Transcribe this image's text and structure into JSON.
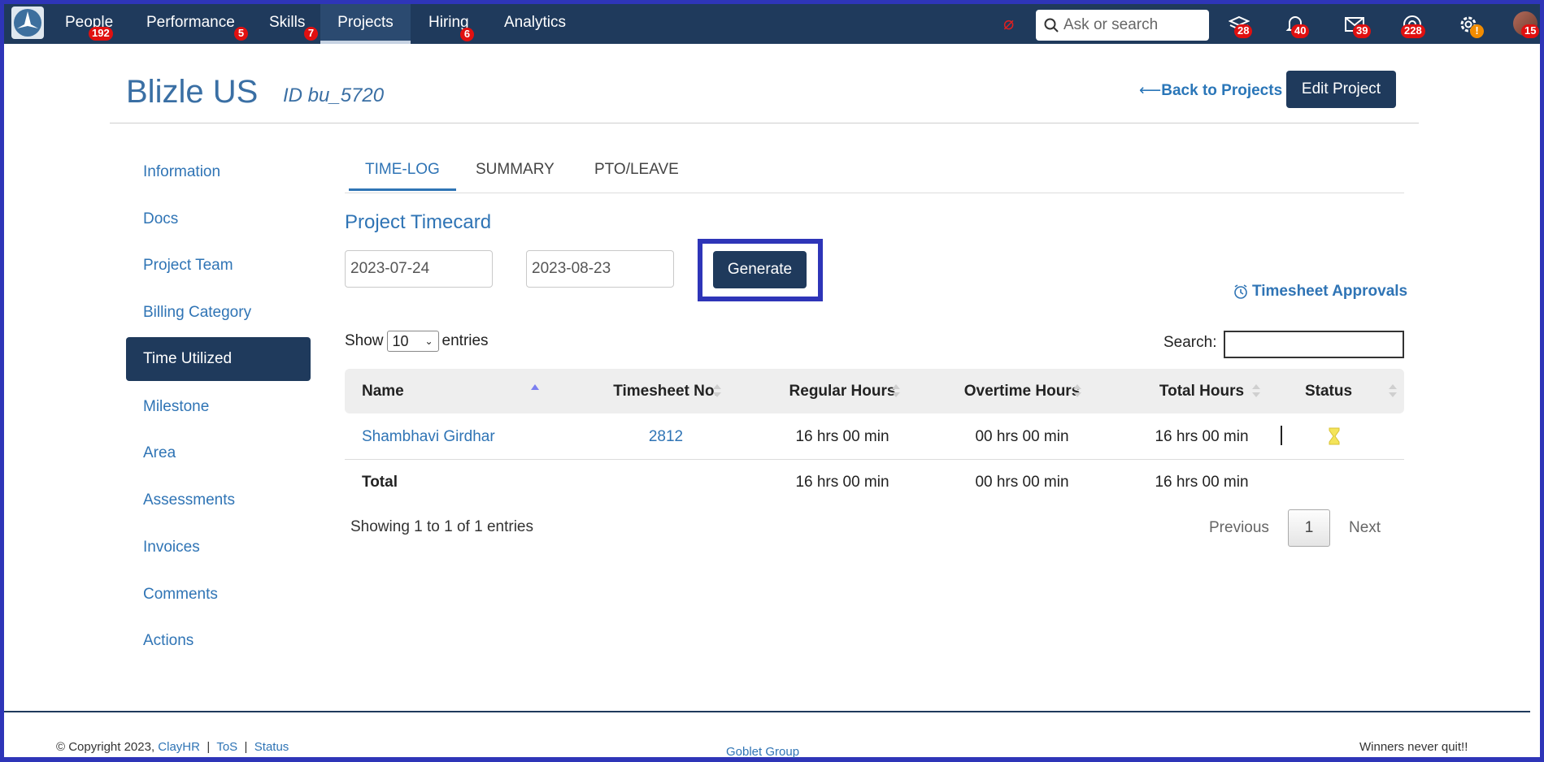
{
  "nav": {
    "items": [
      {
        "label": "People",
        "badge": "192"
      },
      {
        "label": "Performance",
        "badge": "5"
      },
      {
        "label": "Skills",
        "badge": "7"
      },
      {
        "label": "Projects",
        "badge": ""
      },
      {
        "label": "Hiring",
        "badge": "6"
      },
      {
        "label": "Analytics",
        "badge": ""
      }
    ],
    "search_placeholder": "Ask or search",
    "icon_badges": {
      "stack": "28",
      "bell": "40",
      "mail": "39",
      "support": "228",
      "settings": "!",
      "avatar": "15"
    }
  },
  "header": {
    "title": "Blizle US",
    "id_label": "ID bu_5720",
    "back_link": "Back to Projects",
    "edit_button": "Edit Project"
  },
  "sidebar": {
    "items": [
      {
        "label": "Information"
      },
      {
        "label": "Docs"
      },
      {
        "label": "Project Team"
      },
      {
        "label": "Billing Category"
      },
      {
        "label": "Time Utilized"
      },
      {
        "label": "Milestone"
      },
      {
        "label": "Area"
      },
      {
        "label": "Assessments"
      },
      {
        "label": "Invoices"
      },
      {
        "label": "Comments"
      },
      {
        "label": "Actions"
      }
    ]
  },
  "tabs": [
    "TIME-LOG",
    "SUMMARY",
    "PTO/LEAVE"
  ],
  "timecard": {
    "title": "Project Timecard",
    "start_date": "2023-07-24",
    "end_date": "2023-08-23",
    "generate_button": "Generate",
    "approvals_link": "Timesheet Approvals"
  },
  "table_controls": {
    "show_label": "Show",
    "page_size": "10",
    "entries_label": "entries",
    "search_label": "Search:"
  },
  "table": {
    "columns": [
      "Name",
      "Timesheet No.",
      "Regular Hours",
      "Overtime Hours",
      "Total Hours",
      "Status"
    ],
    "rows": [
      {
        "name": "Shambhavi Girdhar",
        "timesheet_no": "2812",
        "regular": "16 hrs 00 min",
        "overtime": "00 hrs 00 min",
        "total": "16 hrs 00 min",
        "status": "pending"
      }
    ],
    "total_row": {
      "label": "Total",
      "regular": "16 hrs 00 min",
      "overtime": "00 hrs 00 min",
      "total": "16 hrs 00 min"
    }
  },
  "pagination": {
    "info": "Showing 1 to 1 of 1 entries",
    "previous": "Previous",
    "current": "1",
    "next": "Next"
  },
  "footer": {
    "copyright": "© Copyright 2023,",
    "company": "ClayHR",
    "sep": "|",
    "tos": "ToS",
    "status": "Status",
    "group": "Goblet Group",
    "tagline": "Winners never quit!!"
  },
  "colors": {
    "nav_bg": "#1f3a5c",
    "accent": "#2f74b5",
    "badge": "#e01010",
    "highlight": "#2e35b8"
  }
}
